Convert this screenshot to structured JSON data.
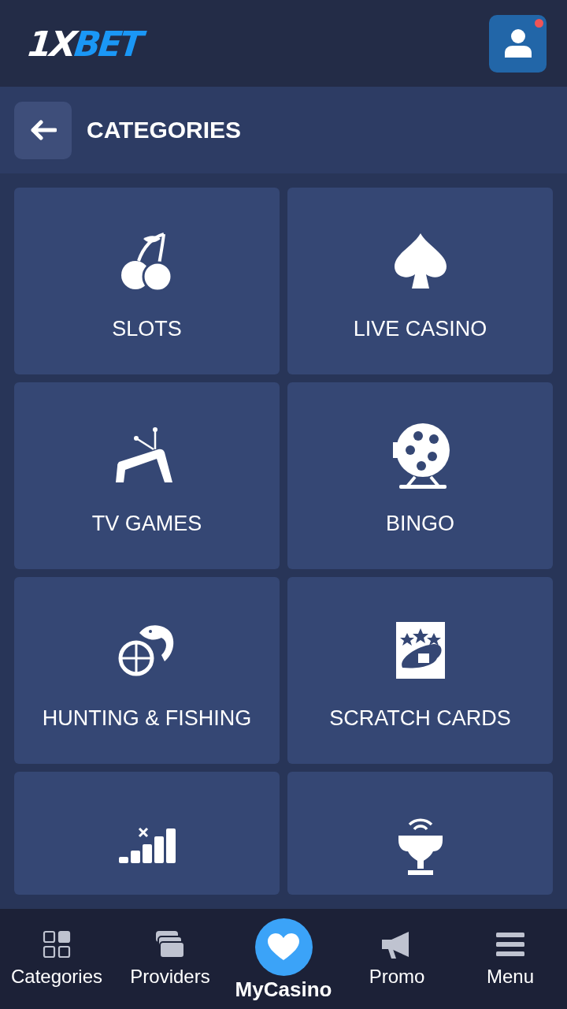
{
  "header": {
    "logo": {
      "first": "1X",
      "second": "BET"
    },
    "profile": {
      "notification": true
    }
  },
  "title_bar": {
    "title": "CATEGORIES"
  },
  "categories": [
    {
      "label": "SLOTS",
      "kind": "cherries"
    },
    {
      "label": "LIVE CASINO",
      "kind": "spade"
    },
    {
      "label": "TV GAMES",
      "kind": "tv"
    },
    {
      "label": "BINGO",
      "kind": "lottery"
    },
    {
      "label": "HUNTING & FISHING",
      "kind": "fish"
    },
    {
      "label": "SCRATCH CARDS",
      "kind": "ticket"
    },
    {
      "kind": "bars"
    },
    {
      "kind": "trophy"
    }
  ],
  "bottom_nav": [
    {
      "label": "Categories",
      "kind": "grid",
      "selected": false
    },
    {
      "label": "Providers",
      "kind": "stack",
      "selected": false
    },
    {
      "label": "MyCasino",
      "kind": "heart",
      "selected": true
    },
    {
      "label": "Promo",
      "kind": "megaphone",
      "selected": false
    },
    {
      "label": "Menu",
      "kind": "menu",
      "selected": false
    }
  ]
}
